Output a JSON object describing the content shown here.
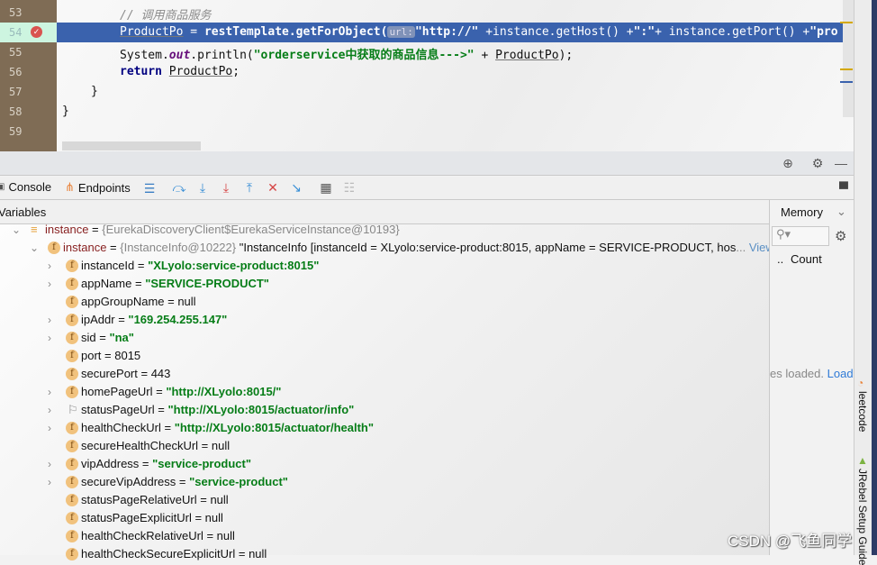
{
  "editor": {
    "lines": [
      {
        "no": "53",
        "comment": "// 调用商品服务"
      },
      {
        "no": "54",
        "var": "ProductPo",
        "eq": " = ",
        "call": "restTemplate.getForObject(",
        "hint": "url:",
        "s1": "\"http://\"",
        "rest": " +instance.getHost() +",
        "s2": "\":\"",
        "rest2": "+ instance.getPort() +",
        "s3": "\"pro"
      },
      {
        "no": "55",
        "pre": "System.",
        "out": "out",
        "mid": ".println(",
        "str": "\"orderservice中获取的商品信息--->\"",
        "post": " + ",
        "var": "ProductPo",
        "end": ");"
      },
      {
        "no": "56",
        "kw": "return",
        "var": "ProductPo",
        "end": ";"
      },
      {
        "no": "57",
        "text": "}"
      },
      {
        "no": "58",
        "text": "}"
      },
      {
        "no": "59",
        "text": ""
      }
    ]
  },
  "toolbar": {
    "console_label": "Console",
    "endpoints_label": "Endpoints"
  },
  "variables": {
    "title": "Variables",
    "root": {
      "name": "instance",
      "eq": " = ",
      "value": "{EurekaDiscoveryClient$EurekaServiceInstance@10193}"
    },
    "child": {
      "name": "instance",
      "eq": " = ",
      "ref": "{InstanceInfo@10222}",
      "value": " \"InstanceInfo [instanceId = XLyolo:service-product:8015, appName = SERVICE-PRODUCT, hos",
      "ellipsis": "...",
      "view": "View"
    },
    "fields": [
      {
        "name": "instanceId",
        "value": "\"XLyolo:service-product:8015\"",
        "str": true,
        "exp": true
      },
      {
        "name": "appName",
        "value": "\"SERVICE-PRODUCT\"",
        "str": true,
        "exp": true
      },
      {
        "name": "appGroupName",
        "value": "null",
        "str": false,
        "exp": false
      },
      {
        "name": "ipAddr",
        "value": "\"169.254.255.147\"",
        "str": true,
        "exp": true
      },
      {
        "name": "sid",
        "value": "\"na\"",
        "str": true,
        "exp": true
      },
      {
        "name": "port",
        "value": "8015",
        "str": false,
        "exp": false
      },
      {
        "name": "securePort",
        "value": "443",
        "str": false,
        "exp": false
      },
      {
        "name": "homePageUrl",
        "value": "\"http://XLyolo:8015/\"",
        "str": true,
        "exp": true
      },
      {
        "name": "statusPageUrl",
        "value": "\"http://XLyolo:8015/actuator/info\"",
        "str": true,
        "exp": true,
        "flag": true
      },
      {
        "name": "healthCheckUrl",
        "value": "\"http://XLyolo:8015/actuator/health\"",
        "str": true,
        "exp": true
      },
      {
        "name": "secureHealthCheckUrl",
        "value": "null",
        "str": false,
        "exp": false
      },
      {
        "name": "vipAddress",
        "value": "\"service-product\"",
        "str": true,
        "exp": true
      },
      {
        "name": "secureVipAddress",
        "value": "\"service-product\"",
        "str": true,
        "exp": true
      },
      {
        "name": "statusPageRelativeUrl",
        "value": "null",
        "str": false,
        "exp": false
      },
      {
        "name": "statusPageExplicitUrl",
        "value": "null",
        "str": false,
        "exp": false
      },
      {
        "name": "healthCheckRelativeUrl",
        "value": "null",
        "str": false,
        "exp": false
      },
      {
        "name": "healthCheckSecureExplicitUrl",
        "value": "null",
        "str": false,
        "exp": false
      }
    ]
  },
  "memory": {
    "tab": "Memory",
    "col_dots": "..",
    "col_count": "Count",
    "status": "es loaded.",
    "load_link": "Load"
  },
  "side_tools": {
    "leetcode": "leetcode",
    "jrebel": "JRebel Setup Guide"
  },
  "watermark": "CSDN @飞鱼同学"
}
